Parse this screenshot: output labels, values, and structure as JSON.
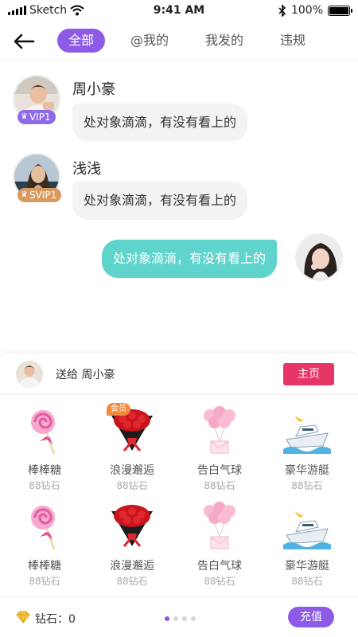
{
  "status_bar": {
    "carrier": "Sketch",
    "time": "9:41 AM",
    "battery": "100%",
    "battery_level": 1.0
  },
  "nav": {
    "tabs": [
      {
        "label": "全部",
        "active": true
      },
      {
        "label": "@我的",
        "active": false
      },
      {
        "label": "我发的",
        "active": false
      },
      {
        "label": "违规",
        "active": false
      }
    ]
  },
  "messages": [
    {
      "nick": "周小豪",
      "badge": "VIP1",
      "badge_type": "vip",
      "text": "处对象滴滴，有没有看上的",
      "direction": "in"
    },
    {
      "nick": "浅浅",
      "badge": "SVIP1",
      "badge_type": "svip",
      "text": "处对象滴滴，有没有看上的",
      "direction": "in"
    },
    {
      "text": "处对象滴滴，有没有看上的",
      "direction": "out"
    }
  ],
  "gift_panel": {
    "send_prefix": "送给 ",
    "recipient": "周小豪",
    "send_label": "送给 周小豪",
    "home_button": "主页",
    "gifts": [
      {
        "name": "棒棒糖",
        "price": "88钻石",
        "icon": "lollipop-icon"
      },
      {
        "name": "浪漫邂逅",
        "price": "88钻石",
        "icon": "rose-bouquet-icon",
        "tag": "会员"
      },
      {
        "name": "告白气球",
        "price": "88钻石",
        "icon": "balloon-icon"
      },
      {
        "name": "豪华游艇",
        "price": "88钻石",
        "icon": "yacht-icon"
      },
      {
        "name": "棒棒糖",
        "price": "88钻石",
        "icon": "lollipop-icon"
      },
      {
        "name": "浪漫邂逅",
        "price": "88钻石",
        "icon": "rose-bouquet-icon"
      },
      {
        "name": "告白气球",
        "price": "88钻石",
        "icon": "balloon-icon"
      },
      {
        "name": "豪华游艇",
        "price": "88钻石",
        "icon": "yacht-icon"
      }
    ],
    "balance_label": "钻石：0",
    "page_dots": 4,
    "active_dot": 0,
    "recharge_button": "充值"
  },
  "colors": {
    "accent": "#8e5be6",
    "teal": "#5fd4cc",
    "pink": "#e83567",
    "vip": "#8e6ae8",
    "svip": "#d79a63"
  }
}
